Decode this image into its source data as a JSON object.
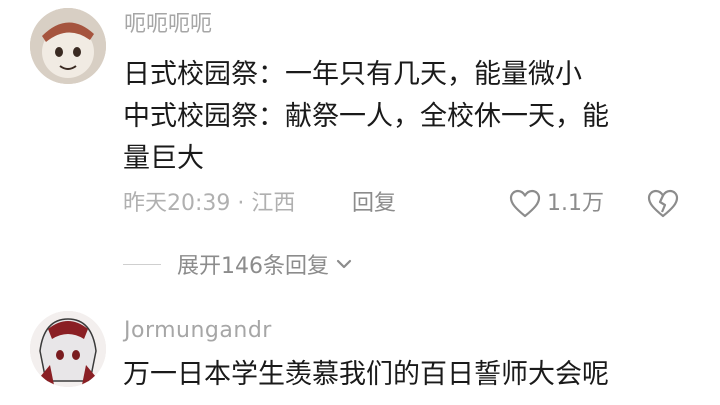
{
  "comment1": {
    "username": "呃呃呃呃",
    "lines": [
      "日式校园祭：一年只有几天，能量微小",
      "中式校园祭：献祭一人，全校休一天，能",
      "量巨大"
    ],
    "time_location": "昨天20:39 · 江西",
    "reply_label": "回复",
    "like_count": "1.1万",
    "expand_label": "展开146条回复"
  },
  "comment2": {
    "username": "Jormungandr",
    "text": "万一日本学生羡慕我们的百日誓师大会呢"
  },
  "icons": {
    "like": "heart-outline-icon",
    "dislike": "broken-heart-icon",
    "expand": "chevron-down-icon"
  },
  "colors": {
    "username": "#a6a6a6",
    "text": "#1a1a1a",
    "meta": "#b0b0b0",
    "action": "#8c8c8c"
  }
}
